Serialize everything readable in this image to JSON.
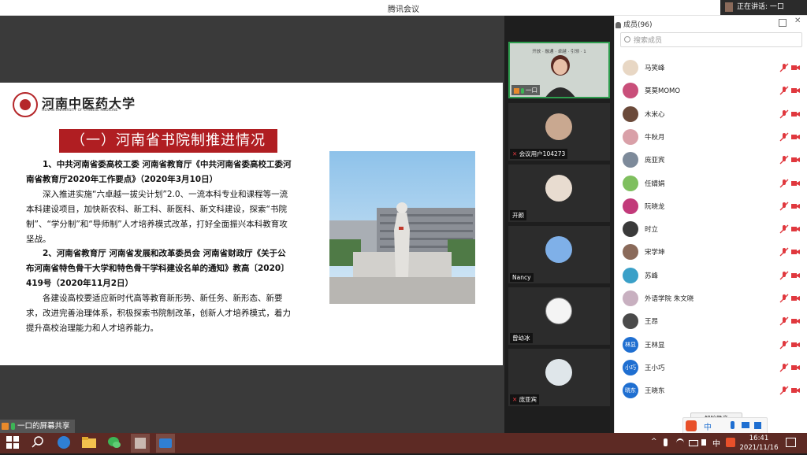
{
  "window": {
    "title": "腾讯会议"
  },
  "speaking": {
    "label": "正在讲话: 一口"
  },
  "slide": {
    "logo_cn": "河南中医药大学",
    "logo_en": "HENAN UNIVERSITY OF CHINESE MEDICINE",
    "heading": "（一）河南省书院制推进情况",
    "p1_title": "1、中共河南省委高校工委 河南省教育厅《中共河南省委高校工委河南省教育厅2020年工作要点》（2020年3月10日）",
    "p1_body": "深入推进实施“六卓越一拔尖计划”2.0、一流本科专业和课程等一流本科建设项目，加快新农科、新工科、新医科、新文科建设，探索“书院制”、“学分制”和“导师制”人才培养模式改革，打好全面振兴本科教育攻坚战。",
    "p2_title": "2、河南省教育厅 河南省发展和改革委员会 河南省财政厅《关于公布河南省特色骨干大学和特色骨干学科建设名单的通知》教高〔2020〕419号（2020年11月2日）",
    "p2_body": "各建设高校要适应新时代高等教育新形势、新任务、新形态、新要求，改进完善治理体系，积极探索书院制改革，创新人才培养模式，着力提升高校治理能力和人才培养能力。"
  },
  "videos": [
    {
      "name": "一口",
      "banner": "开放 · 融通 · 卓越 · 引领 · 1"
    },
    {
      "name": "会议用户104273"
    },
    {
      "name": "开颜"
    },
    {
      "name": "Nancy"
    },
    {
      "name": "曾幼冰"
    },
    {
      "name": "庞亚宾"
    }
  ],
  "members": {
    "header": "成员(96)",
    "search_placeholder": "搜索成员",
    "list": [
      {
        "name": "马笑峰",
        "avatar_color": "#e8d7c4",
        "avatar_text": ""
      },
      {
        "name": "莫莫MOMO",
        "avatar_color": "#c94f7a",
        "avatar_text": ""
      },
      {
        "name": "木米心",
        "avatar_color": "#6b4a3a",
        "avatar_text": ""
      },
      {
        "name": "牛秋月",
        "avatar_color": "#d9a0a8",
        "avatar_text": ""
      },
      {
        "name": "庞亚宾",
        "avatar_color": "#7d8a9a",
        "avatar_text": ""
      },
      {
        "name": "任婧娟",
        "avatar_color": "#7fbf5f",
        "avatar_text": ""
      },
      {
        "name": "阮晓龙",
        "avatar_color": "#c23a7a",
        "avatar_text": ""
      },
      {
        "name": "时立",
        "avatar_color": "#3a3a3a",
        "avatar_text": ""
      },
      {
        "name": "宋学坤",
        "avatar_color": "#8a6a5a",
        "avatar_text": ""
      },
      {
        "name": "苏峰",
        "avatar_color": "#3aa0c8",
        "avatar_text": ""
      },
      {
        "name": "外语学院 朱文晓",
        "avatar_color": "#c8b0c0",
        "avatar_text": ""
      },
      {
        "name": "王昂",
        "avatar_color": "#4a4a4a",
        "avatar_text": ""
      },
      {
        "name": "王林显",
        "avatar_color": "#1f6fd1",
        "avatar_text": "林显"
      },
      {
        "name": "王小巧",
        "avatar_color": "#1f6fd1",
        "avatar_text": "小巧"
      },
      {
        "name": "王晓东",
        "avatar_color": "#1f6fd1",
        "avatar_text": "晓东"
      }
    ],
    "unmute_all": "解除静音"
  },
  "ime": {
    "mode": "中"
  },
  "share_status": {
    "label": "一口的屏幕共享"
  },
  "taskbar": {
    "ime_label": "中",
    "time": "16:41",
    "date": "2021/11/16"
  },
  "colors": {
    "accent": "#2e9d4e",
    "heading_red": "#b01e22",
    "mic_muted": "#e0383e",
    "taskbar": "#5d2a24"
  }
}
